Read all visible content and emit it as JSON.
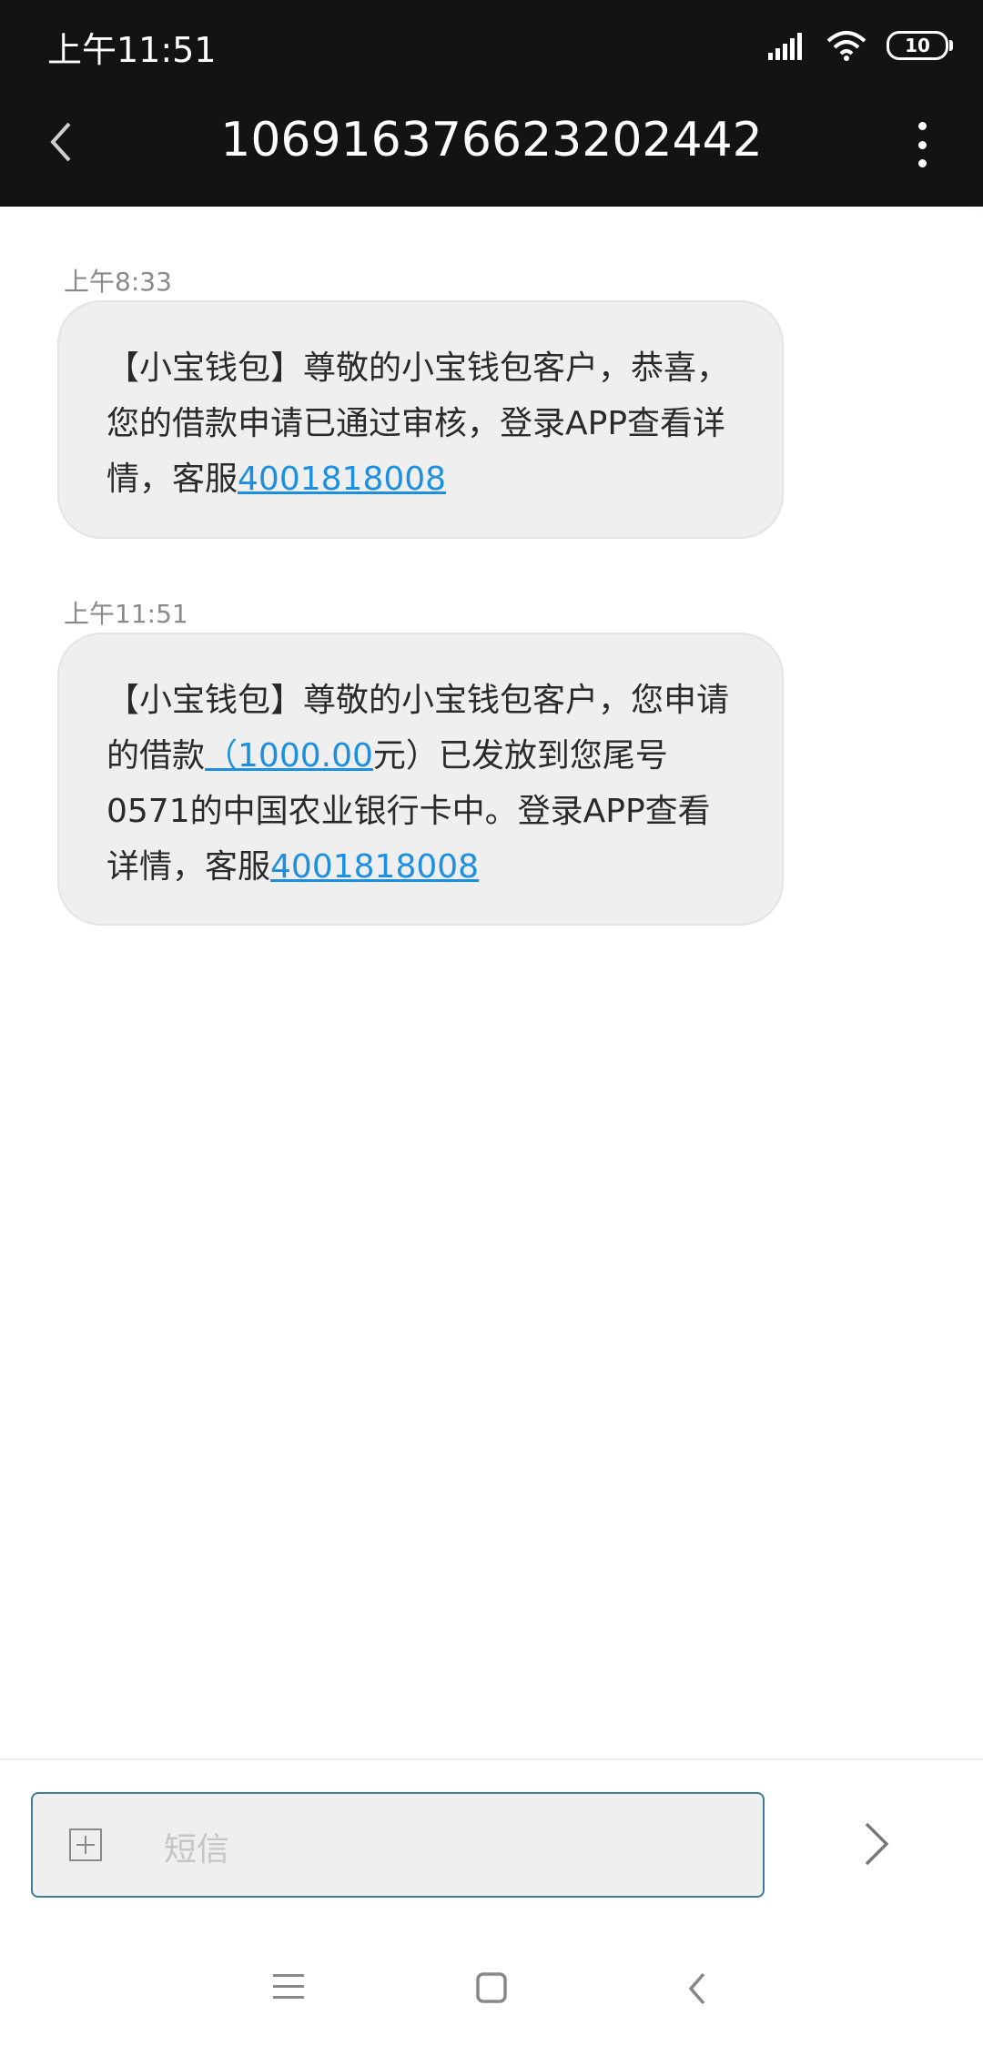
{
  "status_bar": {
    "time": "上午11:51",
    "battery": "10",
    "icons": [
      "signal-icon",
      "wifi-icon",
      "battery-icon"
    ]
  },
  "header": {
    "title": "106916376623202442",
    "back_icon": "chevron-left-icon",
    "more_icon": "more-vertical-icon"
  },
  "messages": [
    {
      "time": "上午8:33",
      "parts": [
        {
          "text": "【小宝钱包】尊敬的小宝钱包客户，恭喜，您的借款申请已通过审核，登录APP查看详情，客服"
        },
        {
          "text": "4001818008",
          "link": true
        }
      ]
    },
    {
      "time": "上午11:51",
      "parts": [
        {
          "text": "【小宝钱包】尊敬的小宝钱包客户，您申请的借款"
        },
        {
          "text": "（1000.00",
          "link": true
        },
        {
          "text": "元）已发放到您尾号0571的中国农业银行卡中。登录APP查看详情，客服"
        },
        {
          "text": "4001818008",
          "link": true
        }
      ]
    }
  ],
  "composer": {
    "placeholder": "短信",
    "attach_icon": "plus-square-icon",
    "send_icon": "chevron-right-icon"
  },
  "nav_bar": {
    "icons": [
      "menu-icon",
      "home-icon",
      "back-icon"
    ]
  },
  "colors": {
    "header_bg": "#141214",
    "bubble_bg": "#efefef",
    "link": "#1d8fe1",
    "input_border": "#3e7d94"
  }
}
